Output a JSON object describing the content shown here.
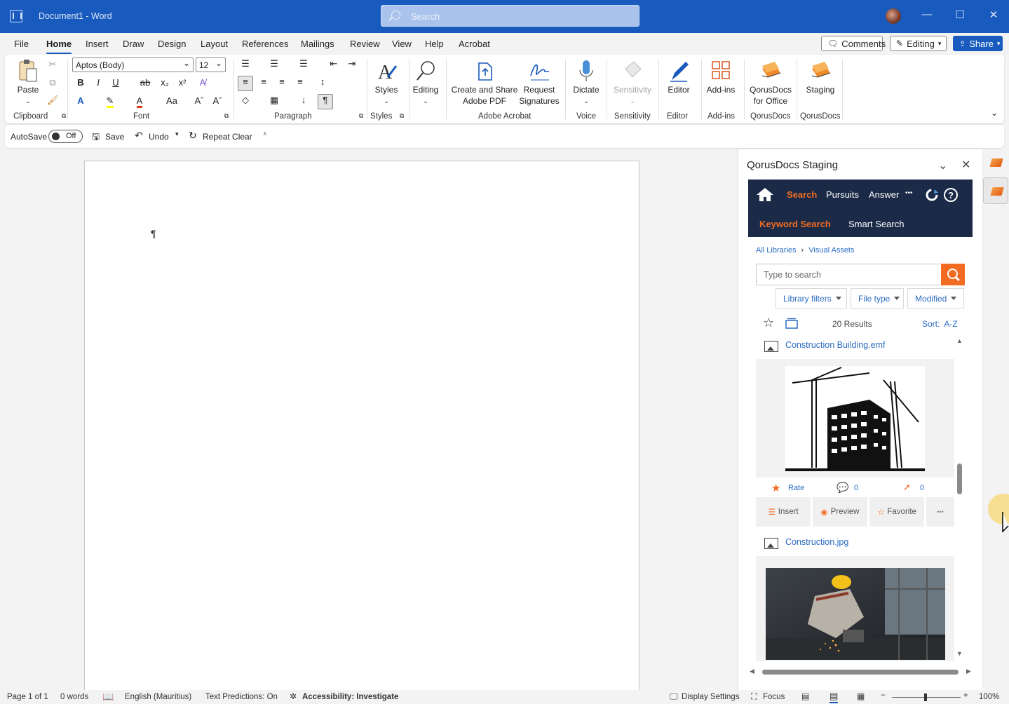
{
  "titlebar": {
    "title": "Document1 - Word",
    "search_placeholder": "Search",
    "minimize": "—",
    "maximize": "☐",
    "close": "✕"
  },
  "menu": {
    "tabs": [
      "File",
      "Home",
      "Insert",
      "Draw",
      "Design",
      "Layout",
      "References",
      "Mailings",
      "Review",
      "View",
      "Help",
      "Acrobat"
    ],
    "comments": "Comments",
    "editing": "Editing",
    "share": "Share"
  },
  "ribbon": {
    "clipboard": {
      "paste": "Paste",
      "label": "Clipboard"
    },
    "font": {
      "name": "Aptos (Body)",
      "size": "12",
      "label": "Font",
      "bold": "B",
      "italic": "I",
      "underline": "U",
      "strike": "ab",
      "sub": "x₂",
      "sup": "x²",
      "case": "Aa"
    },
    "paragraph": {
      "label": "Paragraph"
    },
    "styles": {
      "btn": "Styles",
      "label": "Styles"
    },
    "editing": {
      "btn": "Editing"
    },
    "acrobat": {
      "create_line1": "Create and Share",
      "create_line2": "Adobe PDF",
      "request_line1": "Request",
      "request_line2": "Signatures",
      "label": "Adobe Acrobat"
    },
    "voice": {
      "btn": "Dictate",
      "label": "Voice"
    },
    "sensitivity": {
      "btn": "Sensitivity",
      "label": "Sensitivity"
    },
    "editor": {
      "btn": "Editor",
      "label": "Editor"
    },
    "addins": {
      "btn": "Add-ins",
      "label": "Add-ins"
    },
    "qorus1": {
      "line1": "QorusDocs",
      "line2": "for Office",
      "label": "QorusDocs"
    },
    "qorus2": {
      "btn": "Staging",
      "label": "QorusDocs"
    }
  },
  "qat": {
    "autosave": "AutoSave",
    "toggle": "Off",
    "save": "Save",
    "undo": "Undo",
    "repeat": "Repeat Clear"
  },
  "document": {
    "pilcrow": "¶"
  },
  "pane": {
    "title": "QorusDocs Staging",
    "nav": {
      "search": "Search",
      "pursuits": "Pursuits",
      "answer": "Answer",
      "more": "•••",
      "keyword": "Keyword Search",
      "smart": "Smart Search"
    },
    "crumbs": {
      "root": "All Libraries",
      "sep": "›",
      "current": "Visual Assets"
    },
    "search_placeholder": "Type to search",
    "filters": [
      "Library filters",
      "File type",
      "Modified"
    ],
    "results": "20 Results",
    "sort": "Sort:  A-Z",
    "items": [
      {
        "name": "Construction Building.emf",
        "rate": "Rate",
        "comments": "0",
        "flags": "0"
      },
      {
        "name": "Construction.jpg"
      }
    ],
    "actions": {
      "insert": "Insert",
      "preview": "Preview",
      "favorite": "Favorite",
      "more": "•••"
    }
  },
  "status": {
    "page": "Page 1 of 1",
    "words": "0 words",
    "lang": "English (Mauritius)",
    "pred": "Text Predictions: On",
    "access": "Accessibility: Investigate",
    "display": "Display Settings",
    "focus": "Focus",
    "zoom": "100%"
  },
  "colors": {
    "brand": "#185abd",
    "qorus_orange": "#f26b21",
    "qorus_navy": "#1b2a47"
  }
}
